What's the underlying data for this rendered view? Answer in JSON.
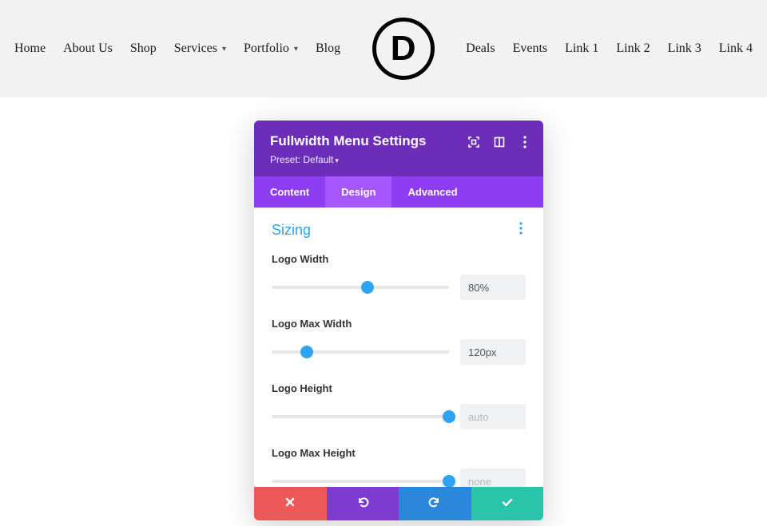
{
  "nav": {
    "left": [
      {
        "label": "Home",
        "dropdown": false
      },
      {
        "label": "About Us",
        "dropdown": false
      },
      {
        "label": "Shop",
        "dropdown": false
      },
      {
        "label": "Services",
        "dropdown": true
      },
      {
        "label": "Portfolio",
        "dropdown": true
      },
      {
        "label": "Blog",
        "dropdown": false
      }
    ],
    "right": [
      {
        "label": "Deals",
        "dropdown": false
      },
      {
        "label": "Events",
        "dropdown": false
      },
      {
        "label": "Link 1",
        "dropdown": false
      },
      {
        "label": "Link 2",
        "dropdown": false
      },
      {
        "label": "Link 3",
        "dropdown": false
      },
      {
        "label": "Link 4",
        "dropdown": false
      }
    ],
    "logo_letter": "D"
  },
  "modal": {
    "title": "Fullwidth Menu Settings",
    "preset_label": "Preset: Default",
    "tabs": {
      "content": "Content",
      "design": "Design",
      "advanced": "Advanced",
      "active": "design"
    },
    "section_title": "Sizing",
    "fields": {
      "logo_width": {
        "label": "Logo Width",
        "value": "80%",
        "pct": 54,
        "muted": false
      },
      "logo_max_width": {
        "label": "Logo Max Width",
        "value": "120px",
        "pct": 20,
        "muted": false
      },
      "logo_height": {
        "label": "Logo Height",
        "value": "auto",
        "pct": 100,
        "muted": true
      },
      "logo_max_height": {
        "label": "Logo Max Height",
        "value": "none",
        "pct": 100,
        "muted": true
      }
    },
    "colors": {
      "header_bg": "#6c2eb9",
      "tab_bg": "#8e3df2",
      "tab_active_bg": "#a657ff",
      "accent": "#2ea3f2",
      "cancel": "#eb5a59",
      "undo": "#7e3bd0",
      "redo": "#2b87da",
      "save": "#29c4a9"
    }
  }
}
